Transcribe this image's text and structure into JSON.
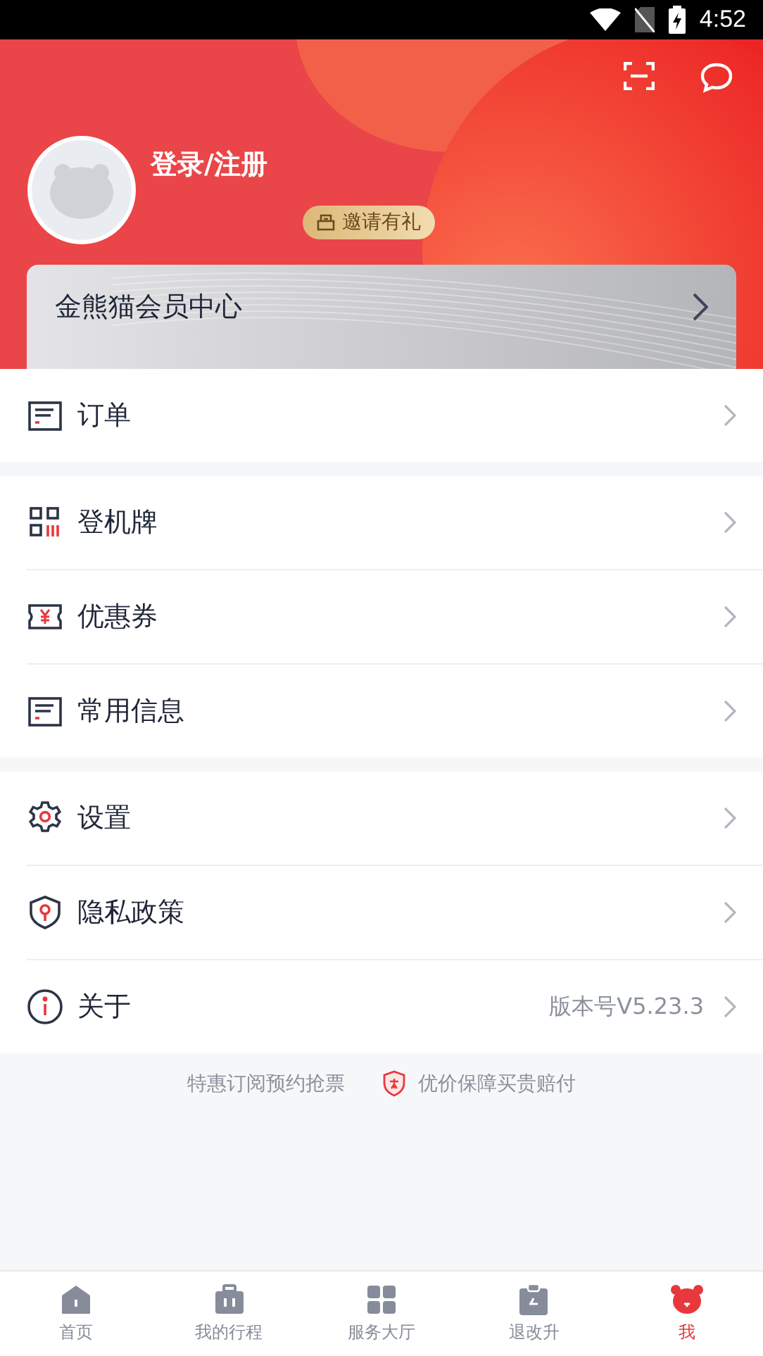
{
  "status_bar": {
    "time": "4:52"
  },
  "header": {
    "login": "登录/注册",
    "invite_badge": "邀请有礼",
    "member_card": "金熊猫会员中心"
  },
  "groups": [
    {
      "items": [
        {
          "label": "订单"
        }
      ]
    },
    {
      "items": [
        {
          "label": "登机牌"
        },
        {
          "label": "优惠券"
        },
        {
          "label": "常用信息"
        }
      ]
    },
    {
      "items": [
        {
          "label": "设置"
        },
        {
          "label": "隐私政策"
        },
        {
          "label": "关于",
          "value": "版本号V5.23.3"
        }
      ]
    }
  ],
  "footer": {
    "left": "特惠订阅预约抢票",
    "right": "优价保障买贵赔付"
  },
  "tabs": [
    {
      "label": "首页",
      "selected": false
    },
    {
      "label": "我的行程",
      "selected": false
    },
    {
      "label": "服务大厅",
      "selected": false
    },
    {
      "label": "退改升",
      "selected": false
    },
    {
      "label": "我",
      "selected": true
    }
  ]
}
